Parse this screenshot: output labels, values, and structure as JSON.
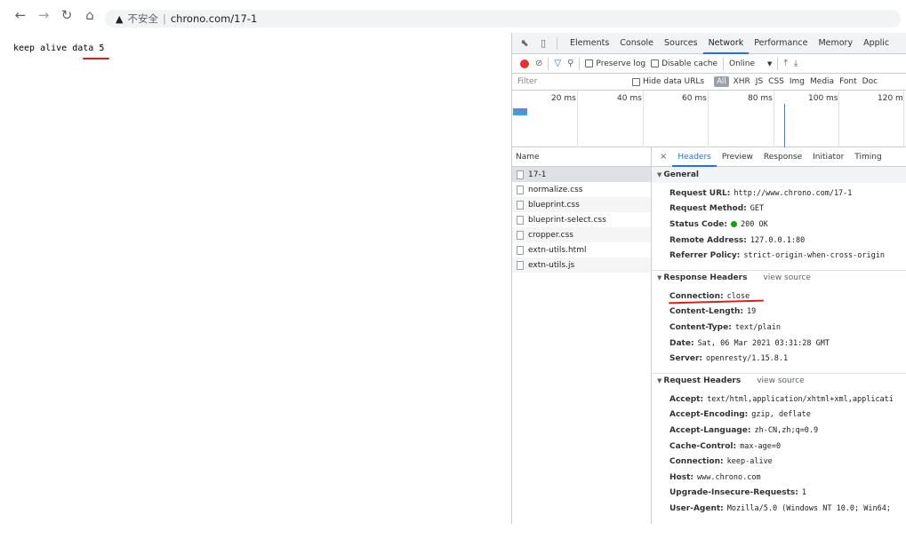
{
  "browser": {
    "nav_icons": [
      "back-arrow-icon",
      "forward-arrow-icon",
      "reload-icon",
      "home-icon"
    ],
    "security_label": "不安全",
    "separator": "|",
    "url": "chrono.com/17-1"
  },
  "page": {
    "body_text": "keep alive data 5"
  },
  "devtools": {
    "tabs": [
      "Elements",
      "Console",
      "Sources",
      "Network",
      "Performance",
      "Memory",
      "Applic"
    ],
    "active_tab": "Network",
    "controls": {
      "preserve_log": "Preserve log",
      "disable_cache": "Disable cache",
      "throttle": "Online"
    },
    "filter": {
      "placeholder": "Filter",
      "hide_data_urls": "Hide data URLs",
      "all": "All",
      "types": [
        "XHR",
        "JS",
        "CSS",
        "Img",
        "Media",
        "Font",
        "Doc"
      ]
    },
    "timeline_ticks": [
      "20 ms",
      "40 ms",
      "60 ms",
      "80 ms",
      "100 ms",
      "120 m"
    ],
    "name_header": "Name",
    "requests": [
      "17-1",
      "normalize.css",
      "blueprint.css",
      "blueprint-select.css",
      "cropper.css",
      "extn-utils.html",
      "extn-utils.js"
    ],
    "detail_tabs": [
      "Headers",
      "Preview",
      "Response",
      "Initiator",
      "Timing"
    ],
    "active_detail_tab": "Headers",
    "general": {
      "title": "General",
      "rows": [
        {
          "key": "Request URL:",
          "value": "http://www.chrono.com/17-1"
        },
        {
          "key": "Request Method:",
          "value": "GET"
        },
        {
          "key": "Status Code:",
          "value": "200 OK"
        },
        {
          "key": "Remote Address:",
          "value": "127.0.0.1:80"
        },
        {
          "key": "Referrer Policy:",
          "value": "strict-origin-when-cross-origin"
        }
      ]
    },
    "response_headers": {
      "title": "Response Headers",
      "view_source": "view source",
      "rows": [
        {
          "key": "Connection:",
          "value": "close"
        },
        {
          "key": "Content-Length:",
          "value": "19"
        },
        {
          "key": "Content-Type:",
          "value": "text/plain"
        },
        {
          "key": "Date:",
          "value": "Sat, 06 Mar 2021 03:31:28 GMT"
        },
        {
          "key": "Server:",
          "value": "openresty/1.15.8.1"
        }
      ]
    },
    "request_headers": {
      "title": "Request Headers",
      "view_source": "view source",
      "rows": [
        {
          "key": "Accept:",
          "value": "text/html,application/xhtml+xml,applicati"
        },
        {
          "key": "Accept-Encoding:",
          "value": "gzip, deflate"
        },
        {
          "key": "Accept-Language:",
          "value": "zh-CN,zh;q=0.9"
        },
        {
          "key": "Cache-Control:",
          "value": "max-age=0"
        },
        {
          "key": "Connection:",
          "value": "keep-alive"
        },
        {
          "key": "Host:",
          "value": "www.chrono.com"
        },
        {
          "key": "Upgrade-Insecure-Requests:",
          "value": "1"
        },
        {
          "key": "User-Agent:",
          "value": "Mozilla/5.0 (Windows NT 10.0; Win64;"
        }
      ]
    }
  },
  "colors": {
    "annotation_red": "#d61f1f",
    "devtools_accent": "#1a73e8",
    "status_ok_green": "#0ca30c",
    "record_red": "#e8312f"
  }
}
